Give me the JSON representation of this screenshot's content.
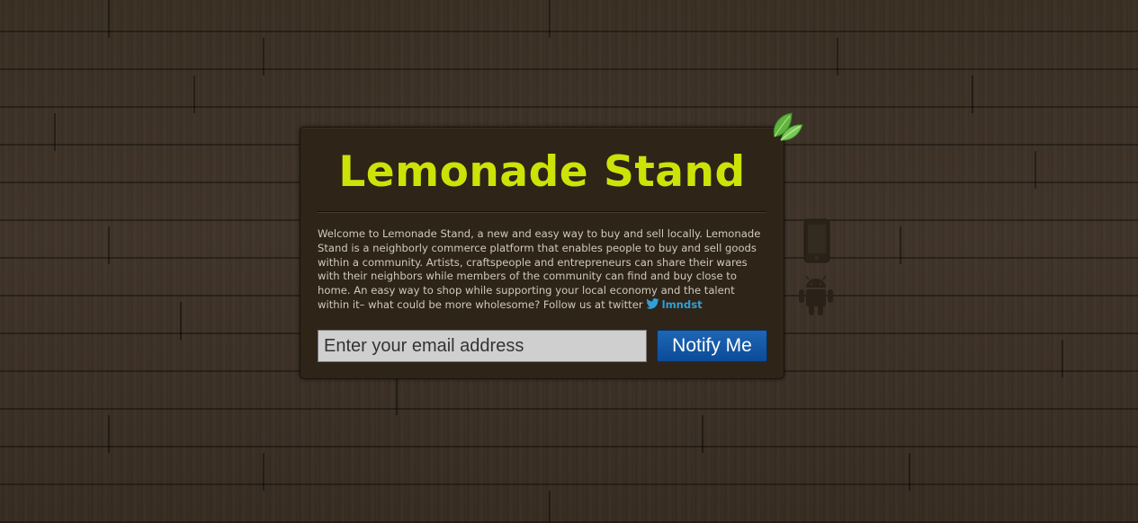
{
  "app": {
    "title": "Lemonade Stand",
    "description": "Welcome to Lemonade Stand, a new and easy way to buy and sell locally. Lemonade Stand is a neighborly commerce platform that enables people to buy and sell goods within a community. Artists, craftspeople and entrepreneurs can share their wares with their neighbors while members of the community can find and buy close to home. An easy way to shop while supporting your local economy and the talent within it– what could be more wholesome? Follow us at twitter",
    "twitter_handle": "lmndst"
  },
  "signup": {
    "email_placeholder": "Enter your email address",
    "email_value": "",
    "notify_label": "Notify Me"
  },
  "icons": {
    "leaf": "leaf-icon",
    "twitter": "twitter-bird-icon",
    "phone": "phone-icon",
    "android": "android-icon"
  },
  "colors": {
    "background_wood": "#3b3024",
    "card_background": "#2e2418",
    "title": "#cde207",
    "body_text": "#cfc9bf",
    "link": "#2fa1d9",
    "button": "#0b4b98",
    "leaf": "#6cc04a"
  }
}
